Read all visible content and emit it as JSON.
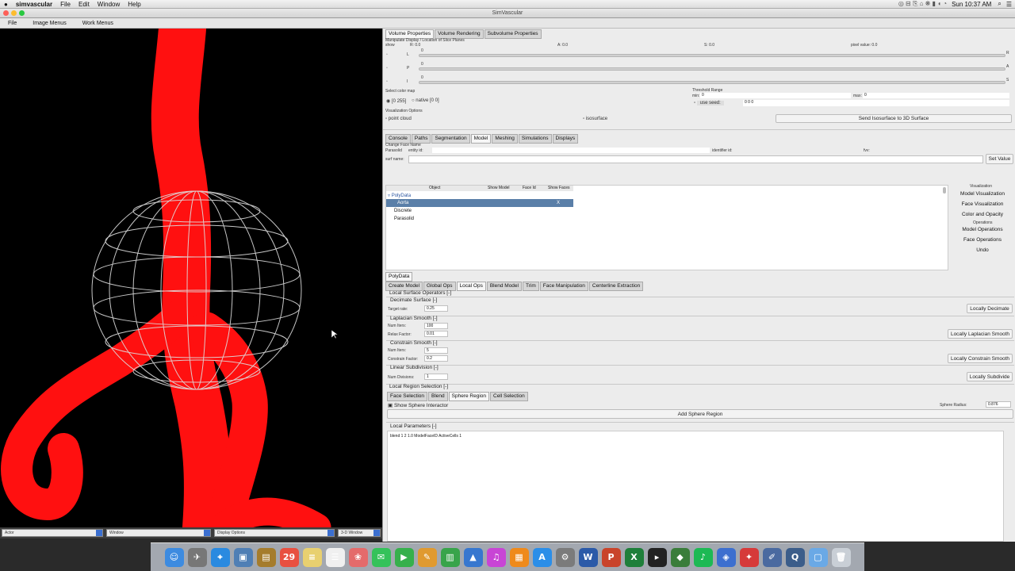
{
  "macmenu": {
    "apple": "",
    "app": "simvascular",
    "items": [
      "File",
      "Edit",
      "Window",
      "Help"
    ],
    "clock": "Sun 10:37 AM"
  },
  "window": {
    "title": "SimVascular"
  },
  "appmenu": [
    "File",
    "Image Menus",
    "Work Menus"
  ],
  "viewer": {
    "selects": [
      "Actor",
      "Window",
      "Display Options",
      "3-D Window"
    ]
  },
  "volume": {
    "tabs": [
      "Volume Properties",
      "Volume Rendering",
      "Subvolume Properties"
    ],
    "heading": "Manipulate Display / Location of Slice Planes",
    "show": "show",
    "r": "R: 0.0",
    "a": "A: 0.0",
    "s": "S: 0.0",
    "pixel": "pixel value: 0.0",
    "rows": [
      {
        "axis": "L",
        "val": "0",
        "end": "R"
      },
      {
        "axis": "P",
        "val": "0",
        "end": "A"
      },
      {
        "axis": "I",
        "val": "0",
        "end": "S"
      }
    ],
    "colormap_label": "Select color map",
    "cm1": "[0 255]",
    "cm2": "native [0 0]",
    "threshold_label": "Threshold Range",
    "min": "min:",
    "min_val": "0",
    "max": "max:",
    "max_val": "0",
    "use_seed": "use seed:",
    "seed_val": "0 0 0",
    "vis_label": "Visualization Options",
    "point_cloud": "point cloud",
    "isosurface": "isosurface",
    "send_btn": "Send Isosurface to 3D Surface"
  },
  "work": {
    "tabs": [
      "Console",
      "Paths",
      "Segmentation",
      "Model",
      "Meshing",
      "Simulations",
      "Displays"
    ],
    "change_face": "Change Face Name",
    "parasolid": "Parasolid",
    "entity": "entity id:",
    "identifier": "identifier id:",
    "fvv": "fvv:",
    "surf_name": "surf name:",
    "set_value": "Set Value",
    "cols": [
      "Object",
      "Show Model",
      "Face Id",
      "Show Faces"
    ],
    "tree": {
      "root": "PolyData",
      "sel": "Aorta",
      "sel_mark": "X",
      "c1": "Discrete",
      "c2": "Parasolid"
    },
    "vis_heading": "Visualization",
    "vis_btns": [
      "Model Visualization",
      "Face Visualization",
      "Color and Opacity"
    ],
    "ops_heading": "Operations",
    "ops_btns": [
      "Model Operations",
      "Face Operations",
      "Undo"
    ]
  },
  "polydata": {
    "title": "PolyData",
    "tabs": [
      "Create Model",
      "Global Ops",
      "Local Ops",
      "Blend Model",
      "Trim",
      "Face Manipulation",
      "Centerline Extraction"
    ],
    "local_ops": "Local Surface Operators [-]",
    "decimate": {
      "title": "Decimate Surface [-]",
      "target": "Target rate:",
      "target_val": "0.25",
      "btn": "Locally Decimate"
    },
    "laplacian": {
      "title": "Laplacian Smooth [-]",
      "iters": "Num Iters:",
      "iters_val": "100",
      "relax": "Relax Factor:",
      "relax_val": "0.01",
      "btn": "Locally Laplacian Smooth"
    },
    "constrain": {
      "title": "Constrain Smooth [-]",
      "iters": "Num Iters:",
      "iters_val": "5",
      "factor": "Constrain Factor:",
      "factor_val": "0.2",
      "btn": "Locally Constrain Smooth"
    },
    "linear": {
      "title": "Linear Subdivision [-]",
      "div": "Num Divisions:",
      "div_val": "1",
      "btn": "Locally Subdivide"
    },
    "region": {
      "title": "Local Region Selection [-]",
      "tabs": [
        "Face Selection",
        "Blend",
        "Sphere Region",
        "Cell Selection"
      ],
      "show_sphere": "Show Sphere Interactor",
      "radius": "Sphere Radius:",
      "radius_val": "0.876",
      "add_btn": "Add Sphere Region"
    },
    "params": {
      "title": "Local Parameters [-]",
      "text": "blend 1 2 1.0 ModelFaceID ActiveCells 1"
    }
  },
  "dock": [
    {
      "name": "finder",
      "ch": "☺",
      "c": "#3d8be0"
    },
    {
      "name": "launchpad",
      "ch": "✈",
      "c": "#777"
    },
    {
      "name": "safari",
      "ch": "⌖",
      "c": "#2a8ae0"
    },
    {
      "name": "preview",
      "ch": "▣",
      "c": "#4f7fb5"
    },
    {
      "name": "notes-app",
      "ch": "▤",
      "c": "#a57c2c"
    },
    {
      "name": "calendar",
      "ch": "29",
      "c": "#e85040"
    },
    {
      "name": "notes",
      "ch": "≡",
      "c": "#e8d070"
    },
    {
      "name": "reminders",
      "ch": "☰",
      "c": "#f0f0f0"
    },
    {
      "name": "photos",
      "ch": "❀",
      "c": "#e46b6b"
    },
    {
      "name": "messages",
      "ch": "✉",
      "c": "#35c25a"
    },
    {
      "name": "facetime",
      "ch": "▶",
      "c": "#36b04c"
    },
    {
      "name": "pages",
      "ch": "✎",
      "c": "#e09a30"
    },
    {
      "name": "numbers",
      "ch": "▥",
      "c": "#38a44a"
    },
    {
      "name": "keynote",
      "ch": "▲",
      "c": "#3777cf"
    },
    {
      "name": "itunes",
      "ch": "♫",
      "c": "#c845d5"
    },
    {
      "name": "ibooks",
      "ch": "▦",
      "c": "#ef8a1b"
    },
    {
      "name": "app-store",
      "ch": "A",
      "c": "#2b8ee8"
    },
    {
      "name": "system-prefs",
      "ch": "⚙",
      "c": "#7b7b7b"
    },
    {
      "name": "word",
      "ch": "W",
      "c": "#2b5aa8"
    },
    {
      "name": "powerpoint",
      "ch": "P",
      "c": "#c9442b"
    },
    {
      "name": "excel",
      "ch": "X",
      "c": "#1e7f3a"
    },
    {
      "name": "terminal",
      "ch": "▸",
      "c": "#222"
    },
    {
      "name": "paraview",
      "ch": "◆",
      "c": "#3a7d3a"
    },
    {
      "name": "spotify",
      "ch": "♪",
      "c": "#1db954"
    },
    {
      "name": "simvascular",
      "ch": "◈",
      "c": "#3d6fcf"
    },
    {
      "name": "screen-tool",
      "ch": "✦",
      "c": "#d63a3a"
    },
    {
      "name": "stylus",
      "ch": "✐",
      "c": "#4a6aa0"
    },
    {
      "name": "quicktime",
      "ch": "Q",
      "c": "#3b5d8a"
    },
    {
      "name": "folder",
      "ch": "▢",
      "c": "#6aa9e6"
    },
    {
      "name": "trash",
      "ch": "🗑",
      "c": "#c9cfd6"
    }
  ]
}
